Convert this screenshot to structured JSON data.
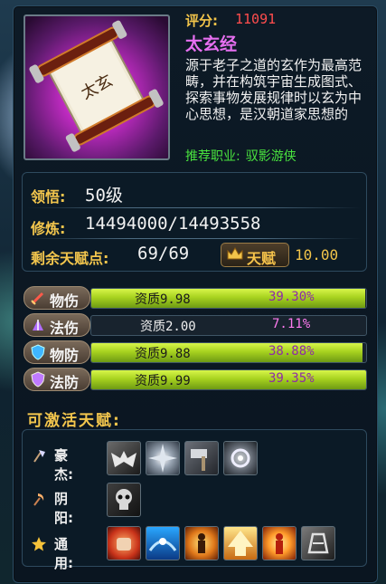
{
  "item": {
    "score_label": "评分:",
    "score_value": "11091",
    "name": "太玄经",
    "description": "源于老子之道的玄作为最高范畴，并在构筑宇宙生成图式、探索事物发展规律时以玄为中心思想，是汉朝道家思想的",
    "recommend_label": "推荐职业:",
    "recommend_value": "驭影游侠",
    "icon": "scroll-icon"
  },
  "stats": {
    "comprehension_label": "领悟:",
    "comprehension_value": "50级",
    "cultivation_label": "修炼:",
    "cultivation_value": "14494000/14493558",
    "talent_points_label": "剩余天赋点:",
    "talent_points_value": "69/69",
    "talent_button_label": "天赋",
    "talent_button_value": "10.00"
  },
  "attributes": [
    {
      "label": "物伤",
      "quality": "资质9.98",
      "percent": "39.30%",
      "fill": 0.998,
      "icon": "sword-icon"
    },
    {
      "label": "法伤",
      "quality": "资质2.00",
      "percent": "7.11%",
      "fill": 0.0,
      "icon": "magic-icon"
    },
    {
      "label": "物防",
      "quality": "资质9.88",
      "percent": "38.88%",
      "fill": 0.988,
      "icon": "shield-icon"
    },
    {
      "label": "法防",
      "quality": "资质9.99",
      "percent": "39.35%",
      "fill": 0.999,
      "icon": "magic-shield-icon"
    }
  ],
  "talents": {
    "section_title": "可激活天赋:",
    "groups": [
      {
        "label": "豪杰:",
        "icon": "axe-icon",
        "skills": [
          "bat-wings-icon",
          "burst-icon",
          "hammer-icon",
          "swirl-icon"
        ]
      },
      {
        "label": "阴阳:",
        "icon": "sickle-icon",
        "skills": [
          "skull-icon"
        ]
      },
      {
        "label": "通用:",
        "icon": "star-icon",
        "skills": [
          "fist-icon",
          "blue-wave-icon",
          "fire-figure-icon",
          "golden-arrow-icon",
          "red-figure-icon",
          "rune-icon"
        ]
      }
    ]
  },
  "colors": {
    "score": "#f2c44a",
    "name": "#e66ff0",
    "recommend": "#49e23e",
    "bar": "#c8ea3a"
  }
}
